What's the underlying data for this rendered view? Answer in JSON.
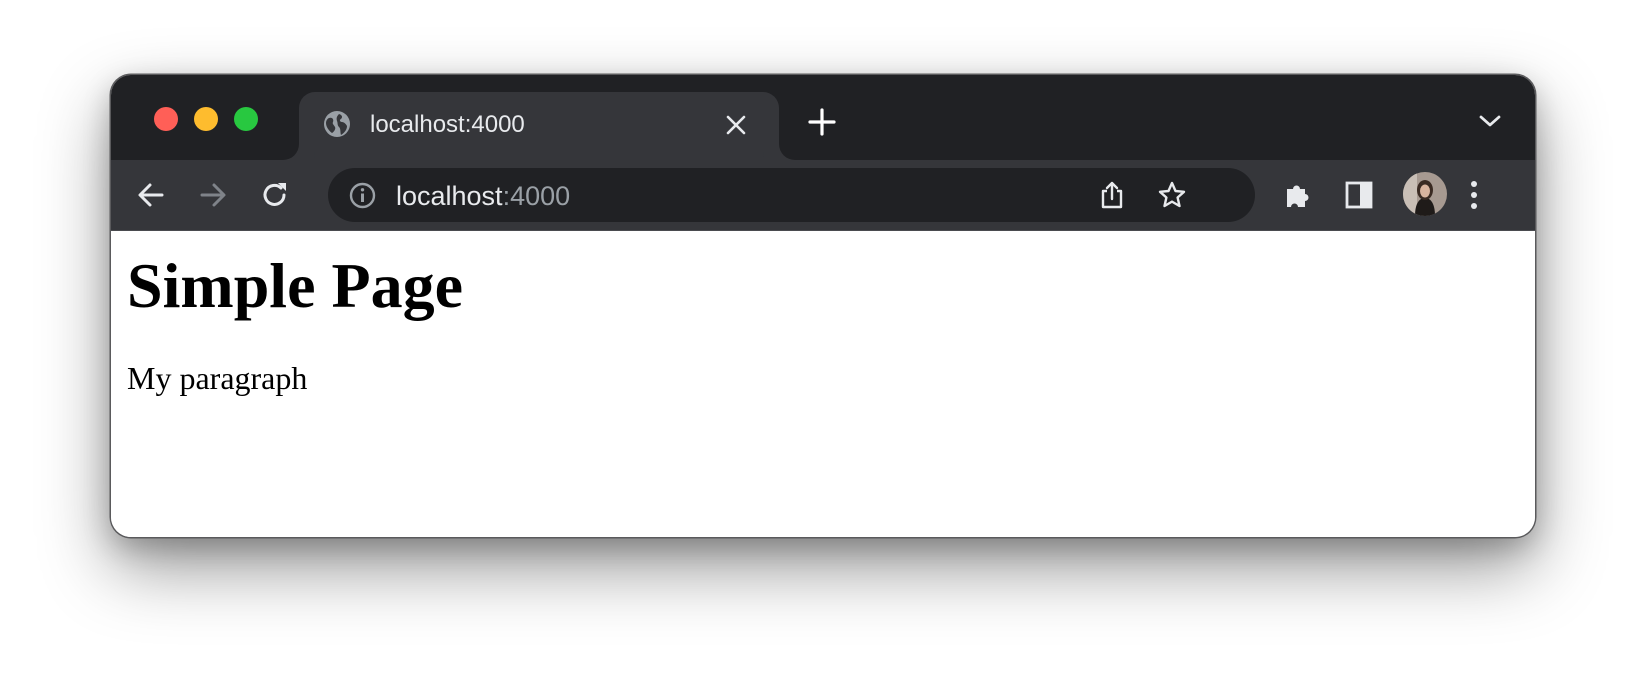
{
  "browser": {
    "tab": {
      "title": "localhost:4000",
      "favicon": "globe-icon"
    },
    "address_bar": {
      "host": "localhost",
      "port": ":4000",
      "info_icon": "info-icon"
    },
    "icons": {
      "back": "arrow-left-icon",
      "forward": "arrow-right-icon",
      "reload": "reload-icon",
      "share": "share-icon",
      "bookmark": "star-icon",
      "extensions": "puzzle-icon",
      "side_panel": "side-panel-icon",
      "menu": "kebab-menu-icon",
      "new_tab": "plus-icon",
      "tab_search": "chevron-down-icon",
      "close_tab": "close-icon"
    },
    "colors": {
      "frame": "#202124",
      "toolbar": "#35363a",
      "omnibox": "#202124",
      "close": "#ff5f57",
      "minimize": "#febc2e",
      "zoom": "#28c840"
    }
  },
  "page": {
    "heading": "Simple Page",
    "paragraph": "My paragraph"
  }
}
